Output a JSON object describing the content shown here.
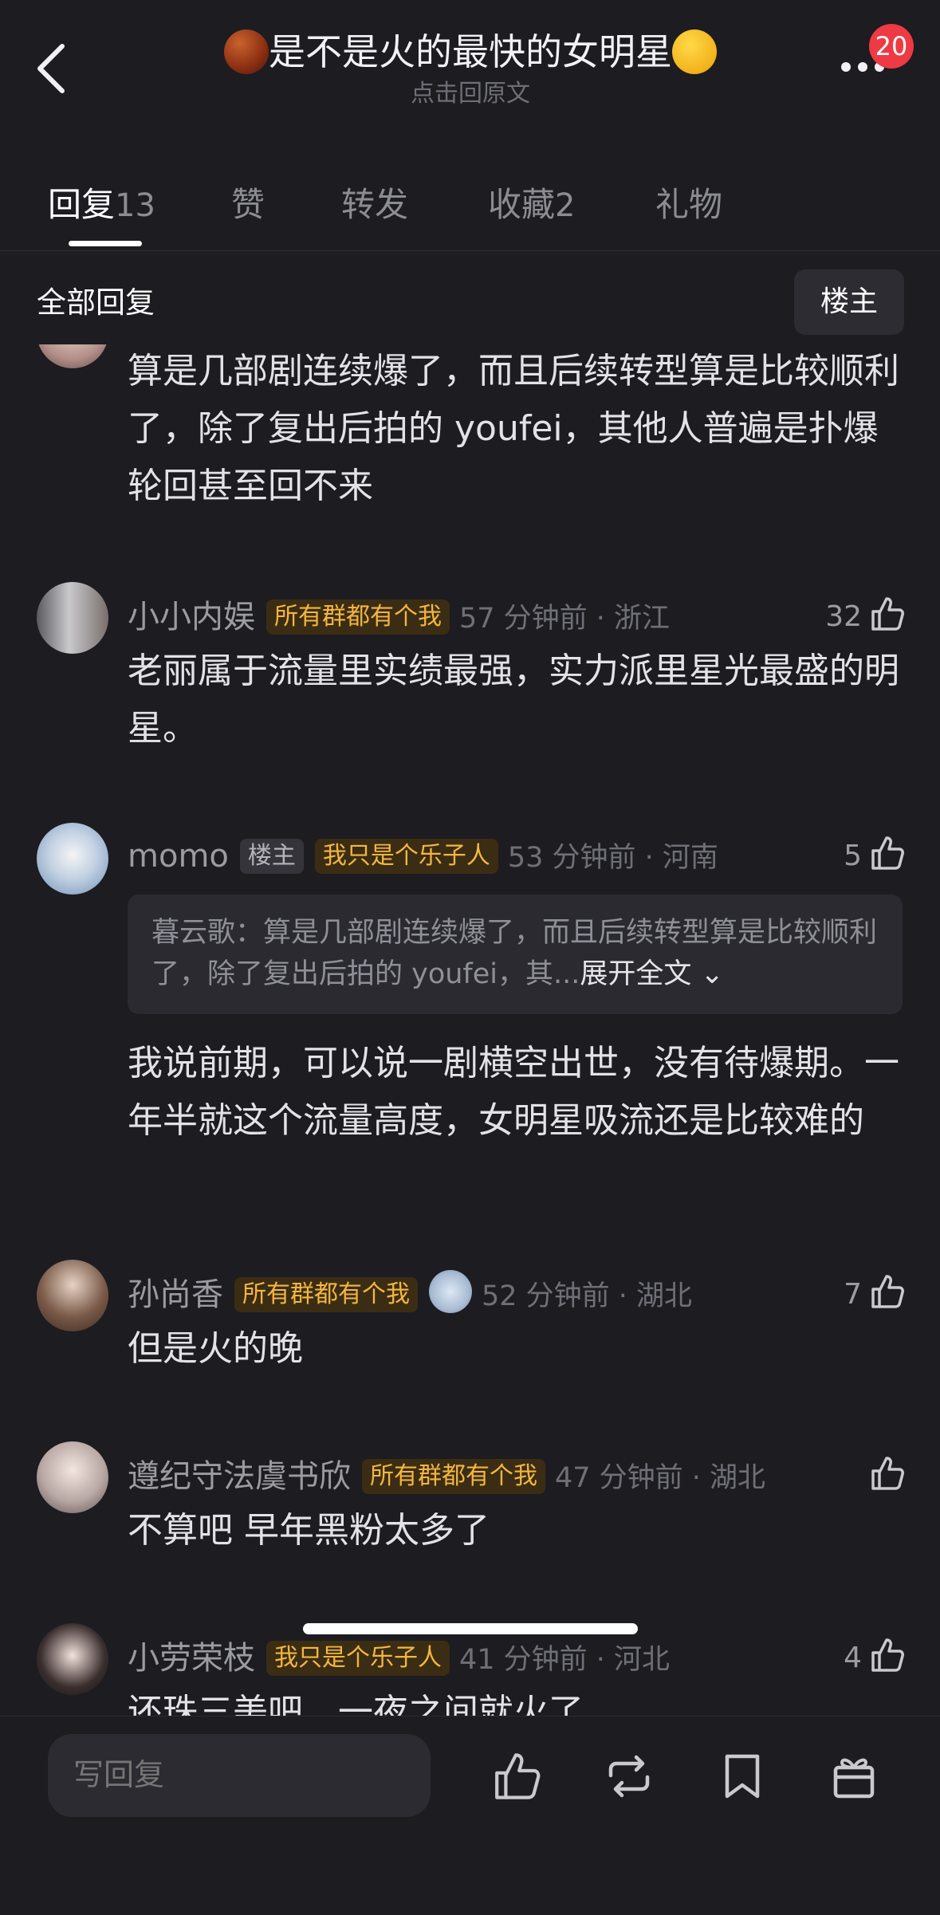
{
  "header": {
    "title": "是不是火的最快的女明星",
    "subtitle": "点击回原文",
    "notification_count": "20",
    "title_emoji_left": "chestnut-emoji",
    "title_emoji_right": "thinking-face-emoji"
  },
  "tabs": [
    {
      "label": "回复",
      "count": "13"
    },
    {
      "label": "赞",
      "count": ""
    },
    {
      "label": "转发",
      "count": ""
    },
    {
      "label": "收藏",
      "count": "2"
    },
    {
      "label": "礼物",
      "count": ""
    }
  ],
  "filter": {
    "label": "全部回复",
    "button": "楼主"
  },
  "comments": [
    {
      "body": "算是几部剧连续爆了，而且后续转型算是比较顺利了，除了复出后拍的 youfei，其他人普遍是扑爆轮回甚至回不来"
    },
    {
      "username": "小小内娱",
      "fan_tag": "所有群都有个我",
      "time": "57 分钟前 · 浙江",
      "likes": "32",
      "body": "老丽属于流量里实绩最强，实力派里星光最盛的明星。"
    },
    {
      "username": "momo",
      "op_tag": "楼主",
      "fan_tag": "我只是个乐子人",
      "time": "53 分钟前 · 河南",
      "likes": "5",
      "quote_text": "暮云歌：算是几部剧连续爆了，而且后续转型算是比较顺利了，除了复出后拍的 youfei，其...",
      "quote_expand": "展开全文",
      "body": "我说前期，可以说一剧横空出世，没有待爆期。一年半就这个流量高度，女明星吸流还是比较难的"
    },
    {
      "username": "孙尚香",
      "fan_tag": "所有群都有个我",
      "time": "52 分钟前 · 湖北",
      "likes": "7",
      "body": "但是火的晚"
    },
    {
      "username": "遵纪守法虞书欣",
      "fan_tag": "所有群都有个我",
      "time": "47 分钟前 · 湖北",
      "likes": "",
      "body": "不算吧 早年黑粉太多了"
    },
    {
      "username": "小劳荣枝",
      "fan_tag": "我只是个乐子人",
      "time": "41 分钟前 · 河北",
      "likes": "4",
      "body": "还珠三美吧，一夜之间就火了"
    }
  ],
  "bottom_bar": {
    "reply_placeholder": "写回复"
  },
  "colors": {
    "background": "#1c1c21",
    "badge_red": "#ee3a43",
    "fan_tag_text": "#f4b63f",
    "fan_tag_bg": "#3b2d14"
  }
}
